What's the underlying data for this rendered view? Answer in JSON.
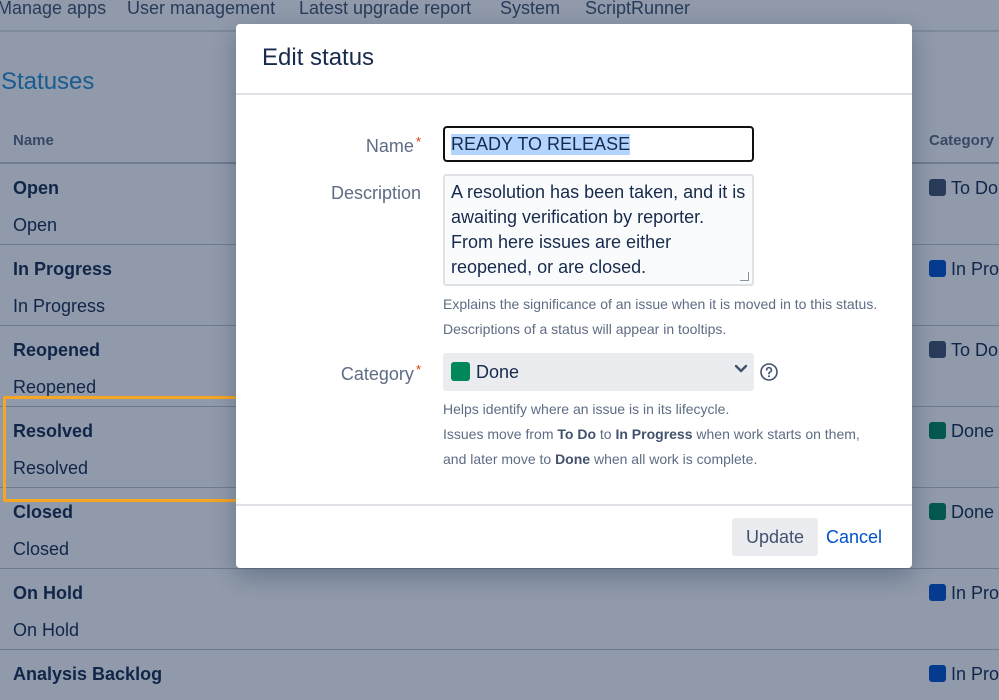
{
  "nav": {
    "items": [
      "Manage apps",
      "User management",
      "Latest upgrade report",
      "System",
      "ScriptRunner"
    ]
  },
  "page": {
    "title": "Statuses",
    "col_name": "Name",
    "col_category": "Category"
  },
  "statuses": [
    {
      "name": "Open",
      "description": "Open",
      "category": "To Do",
      "color": "#42526e"
    },
    {
      "name": "In Progress",
      "description": "In Progress",
      "category": "In Prog",
      "color": "#0052cc"
    },
    {
      "name": "Reopened",
      "description": "Reopened",
      "category": "To Do",
      "color": "#42526e"
    },
    {
      "name": "Resolved",
      "description": "Resolved",
      "category": "Done",
      "color": "#00875a"
    },
    {
      "name": "Closed",
      "description": "Closed",
      "category": "Done",
      "color": "#00875a"
    },
    {
      "name": "On Hold",
      "description": "On Hold",
      "category": "In Prog",
      "color": "#0052cc"
    },
    {
      "name": "Analysis Backlog",
      "description": "",
      "category": "In Prog",
      "color": "#0052cc"
    }
  ],
  "dialog": {
    "title": "Edit status",
    "name_label": "Name",
    "name_value": "READY TO RELEASE",
    "description_label": "Description",
    "description_value": "A resolution has been taken, and it is awaiting verification by reporter. From here issues are either reopened, or are closed.",
    "description_help": "Explains the significance of an issue when it is moved in to this status. Descriptions of a status will appear in tooltips.",
    "category_label": "Category",
    "category_value": "Done",
    "category_color": "#00875a",
    "category_help_1": "Helps identify where an issue is in its lifecycle.",
    "category_help_2_a": "Issues move from ",
    "category_help_2_b": "To Do",
    "category_help_2_c": " to ",
    "category_help_2_d": "In Progress",
    "category_help_2_e": " when work starts on them,",
    "category_help_3_a": "and later move to ",
    "category_help_3_b": "Done",
    "category_help_3_c": " when all work is complete.",
    "update_label": "Update",
    "cancel_label": "Cancel"
  },
  "colors": {
    "accent": "#0052cc",
    "highlight": "#f5a623",
    "done": "#00875a",
    "todo": "#42526e",
    "in_progress": "#0052cc"
  }
}
